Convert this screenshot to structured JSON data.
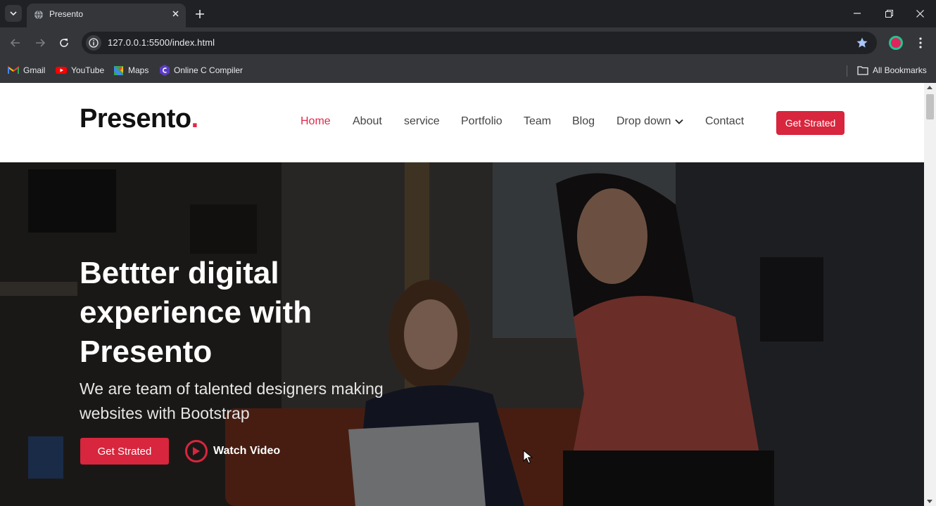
{
  "browser": {
    "tab_title": "Presento",
    "url": "127.0.0.1:5500/index.html",
    "bookmarks": [
      {
        "label": "Gmail",
        "icon": "gmail-icon"
      },
      {
        "label": "YouTube",
        "icon": "youtube-icon"
      },
      {
        "label": "Maps",
        "icon": "maps-icon"
      },
      {
        "label": "Online C Compiler",
        "icon": "compiler-icon"
      }
    ],
    "all_bookmarks": "All Bookmarks"
  },
  "site": {
    "logo_text": "Presento",
    "logo_dot": ".",
    "nav": [
      "Home",
      "About",
      "service",
      "Portfolio",
      "Team",
      "Blog",
      "Drop down",
      "Contact"
    ],
    "active_nav": "Home",
    "header_cta": "Get Strated",
    "accent_color": "#d7263d"
  },
  "hero": {
    "title_line1": "Bettter digital",
    "title_line2": "experience with",
    "title_line3": "Presento",
    "subtitle_line1": "We are team of talented designers making",
    "subtitle_line2": "websites with Bootstrap",
    "cta": "Get Strated",
    "watch_video": "Watch Video"
  }
}
